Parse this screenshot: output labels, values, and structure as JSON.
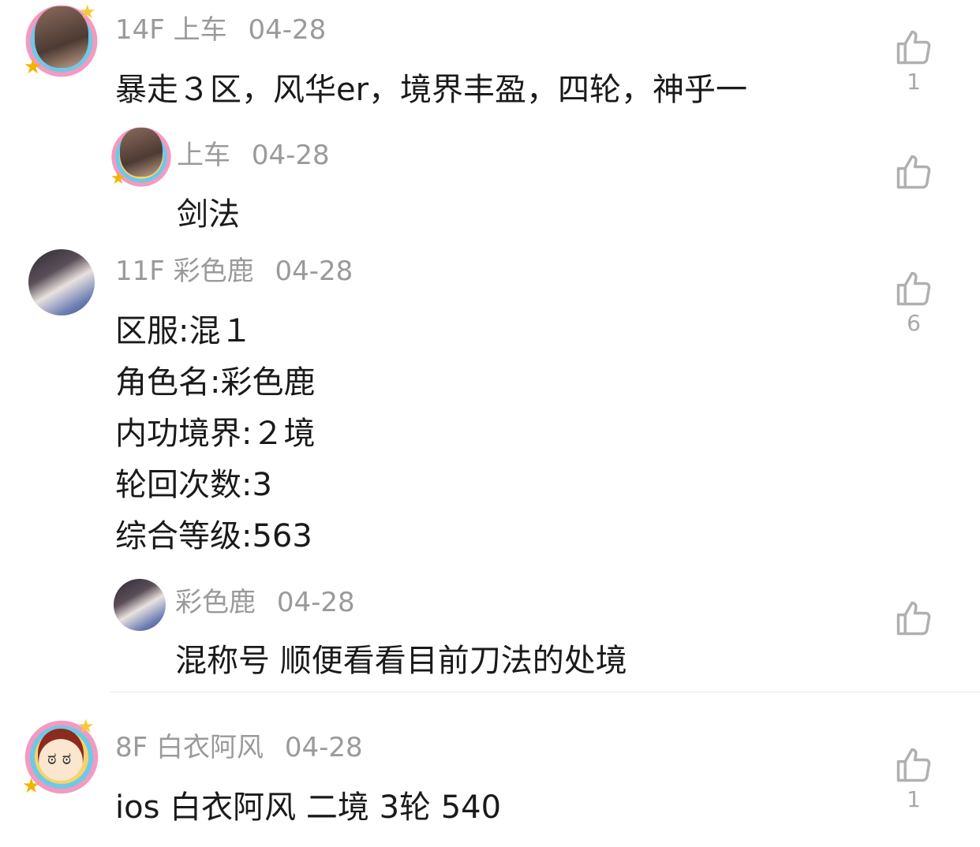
{
  "comments": [
    {
      "floor": "14F",
      "user": "上车",
      "date": "04-28",
      "text": "暴走３区，风华er，境界丰盈，四轮，神乎一",
      "likes": "1",
      "reply": {
        "user": "上车",
        "date": "04-28",
        "text": "剑法"
      }
    },
    {
      "floor": "11F",
      "user": "彩色鹿",
      "date": "04-28",
      "lines": [
        "区服:混１",
        "角色名:彩色鹿",
        "内功境界:２境",
        "轮回次数:3",
        "综合等级:563"
      ],
      "likes": "6",
      "reply": {
        "user": "彩色鹿",
        "date": "04-28",
        "text": "混称号 顺便看看目前刀法的处境"
      }
    },
    {
      "floor": "8F",
      "user": "白衣阿风",
      "date": "04-28",
      "text": "ios 白衣阿风 二境 3轮 540",
      "likes": "1"
    }
  ],
  "icons": {
    "like": "thumbs-up-icon"
  },
  "colors": {
    "meta": "#9a9a9a",
    "text": "#1a1a1a",
    "icon": "#b0b0b0",
    "divider": "#e6e6e6"
  }
}
